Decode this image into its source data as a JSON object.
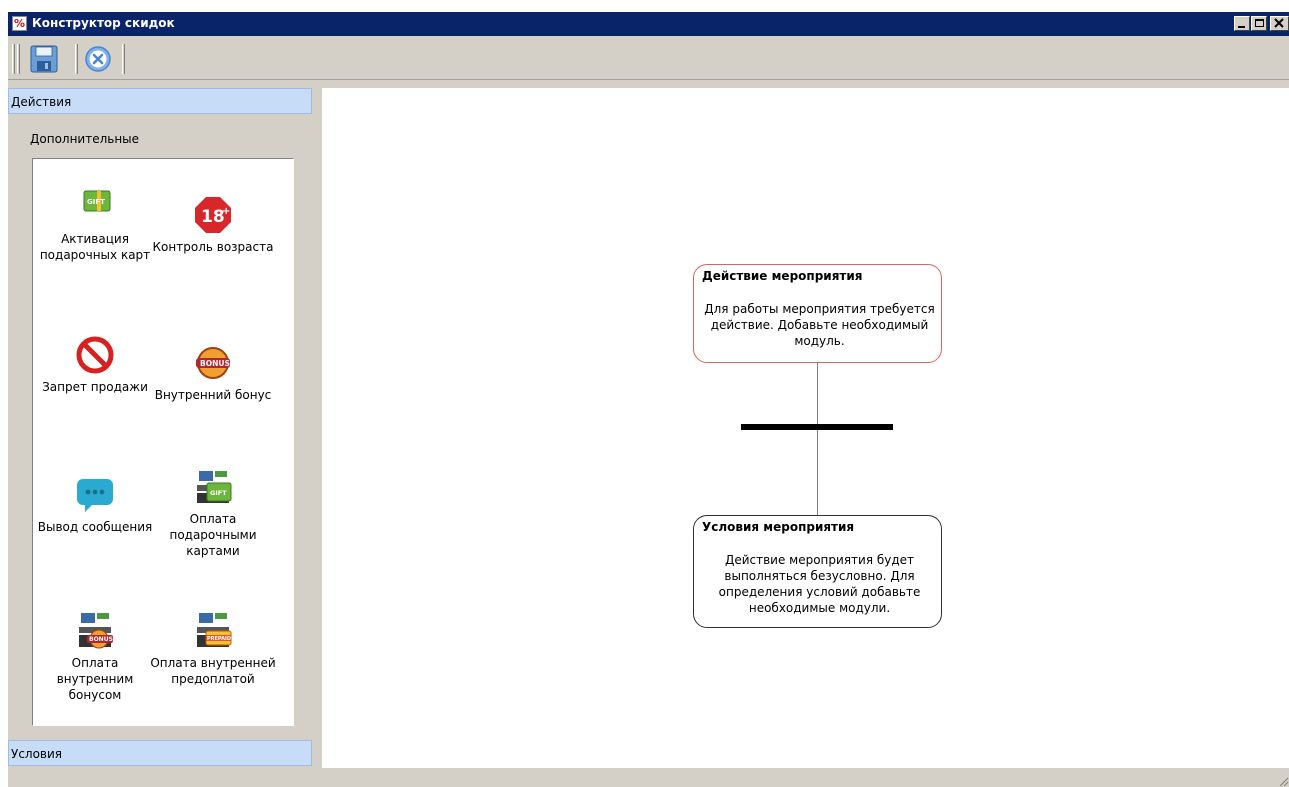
{
  "window": {
    "title": "Конструктор скидок"
  },
  "toolbar": {
    "save_icon": "floppy-save-icon",
    "cancel_icon": "close-circle-icon"
  },
  "sidebar": {
    "actions_header": "Действия",
    "group_title": "Дополнительные",
    "items": [
      {
        "label": "Активация подарочных карт",
        "icon": "gift-card-icon"
      },
      {
        "label": "Контроль возраста",
        "icon": "age-18-icon"
      },
      {
        "label": "Запрет продажи",
        "icon": "no-sale-icon"
      },
      {
        "label": "Внутренний бонус",
        "icon": "bonus-icon"
      },
      {
        "label": "Вывод сообщения",
        "icon": "message-icon"
      },
      {
        "label": "Оплата подарочными картами",
        "icon": "gift-card-payment-icon"
      },
      {
        "label": "Оплата внутренним бонусом",
        "icon": "bonus-payment-icon"
      },
      {
        "label": "Оплата внутренней предоплатой",
        "icon": "prepaid-payment-icon"
      }
    ],
    "conditions_header": "Условия"
  },
  "canvas": {
    "action_node": {
      "title": "Действие мероприятия",
      "description": "Для работы мероприятия требуется действие. Добавьте необходимый модуль."
    },
    "condition_node": {
      "title": "Условия мероприятия",
      "description": "Действие мероприятия будет выполняться безусловно. Для определения условий добавьте необходимые модули."
    }
  },
  "colors": {
    "titlebar": "#0a246a",
    "panel_header": "#c6dcf7",
    "action_border": "#e06060"
  }
}
